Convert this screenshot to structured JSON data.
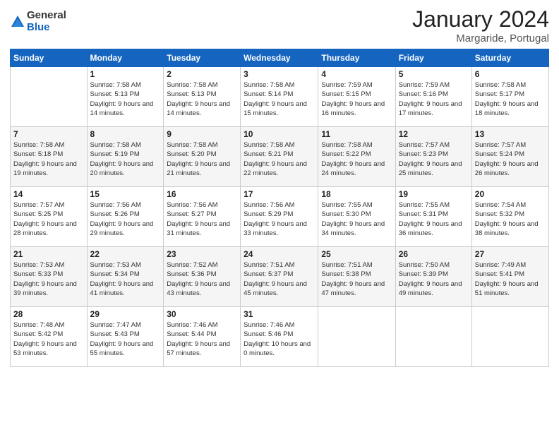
{
  "logo": {
    "general": "General",
    "blue": "Blue"
  },
  "header": {
    "title": "January 2024",
    "subtitle": "Margaride, Portugal"
  },
  "weekdays": [
    "Sunday",
    "Monday",
    "Tuesday",
    "Wednesday",
    "Thursday",
    "Friday",
    "Saturday"
  ],
  "weeks": [
    [
      {
        "day": "",
        "sunrise": "",
        "sunset": "",
        "daylight": ""
      },
      {
        "day": "1",
        "sunrise": "Sunrise: 7:58 AM",
        "sunset": "Sunset: 5:13 PM",
        "daylight": "Daylight: 9 hours and 14 minutes."
      },
      {
        "day": "2",
        "sunrise": "Sunrise: 7:58 AM",
        "sunset": "Sunset: 5:13 PM",
        "daylight": "Daylight: 9 hours and 14 minutes."
      },
      {
        "day": "3",
        "sunrise": "Sunrise: 7:58 AM",
        "sunset": "Sunset: 5:14 PM",
        "daylight": "Daylight: 9 hours and 15 minutes."
      },
      {
        "day": "4",
        "sunrise": "Sunrise: 7:59 AM",
        "sunset": "Sunset: 5:15 PM",
        "daylight": "Daylight: 9 hours and 16 minutes."
      },
      {
        "day": "5",
        "sunrise": "Sunrise: 7:59 AM",
        "sunset": "Sunset: 5:16 PM",
        "daylight": "Daylight: 9 hours and 17 minutes."
      },
      {
        "day": "6",
        "sunrise": "Sunrise: 7:58 AM",
        "sunset": "Sunset: 5:17 PM",
        "daylight": "Daylight: 9 hours and 18 minutes."
      }
    ],
    [
      {
        "day": "7",
        "sunrise": "Sunrise: 7:58 AM",
        "sunset": "Sunset: 5:18 PM",
        "daylight": "Daylight: 9 hours and 19 minutes."
      },
      {
        "day": "8",
        "sunrise": "Sunrise: 7:58 AM",
        "sunset": "Sunset: 5:19 PM",
        "daylight": "Daylight: 9 hours and 20 minutes."
      },
      {
        "day": "9",
        "sunrise": "Sunrise: 7:58 AM",
        "sunset": "Sunset: 5:20 PM",
        "daylight": "Daylight: 9 hours and 21 minutes."
      },
      {
        "day": "10",
        "sunrise": "Sunrise: 7:58 AM",
        "sunset": "Sunset: 5:21 PM",
        "daylight": "Daylight: 9 hours and 22 minutes."
      },
      {
        "day": "11",
        "sunrise": "Sunrise: 7:58 AM",
        "sunset": "Sunset: 5:22 PM",
        "daylight": "Daylight: 9 hours and 24 minutes."
      },
      {
        "day": "12",
        "sunrise": "Sunrise: 7:57 AM",
        "sunset": "Sunset: 5:23 PM",
        "daylight": "Daylight: 9 hours and 25 minutes."
      },
      {
        "day": "13",
        "sunrise": "Sunrise: 7:57 AM",
        "sunset": "Sunset: 5:24 PM",
        "daylight": "Daylight: 9 hours and 26 minutes."
      }
    ],
    [
      {
        "day": "14",
        "sunrise": "Sunrise: 7:57 AM",
        "sunset": "Sunset: 5:25 PM",
        "daylight": "Daylight: 9 hours and 28 minutes."
      },
      {
        "day": "15",
        "sunrise": "Sunrise: 7:56 AM",
        "sunset": "Sunset: 5:26 PM",
        "daylight": "Daylight: 9 hours and 29 minutes."
      },
      {
        "day": "16",
        "sunrise": "Sunrise: 7:56 AM",
        "sunset": "Sunset: 5:27 PM",
        "daylight": "Daylight: 9 hours and 31 minutes."
      },
      {
        "day": "17",
        "sunrise": "Sunrise: 7:56 AM",
        "sunset": "Sunset: 5:29 PM",
        "daylight": "Daylight: 9 hours and 33 minutes."
      },
      {
        "day": "18",
        "sunrise": "Sunrise: 7:55 AM",
        "sunset": "Sunset: 5:30 PM",
        "daylight": "Daylight: 9 hours and 34 minutes."
      },
      {
        "day": "19",
        "sunrise": "Sunrise: 7:55 AM",
        "sunset": "Sunset: 5:31 PM",
        "daylight": "Daylight: 9 hours and 36 minutes."
      },
      {
        "day": "20",
        "sunrise": "Sunrise: 7:54 AM",
        "sunset": "Sunset: 5:32 PM",
        "daylight": "Daylight: 9 hours and 38 minutes."
      }
    ],
    [
      {
        "day": "21",
        "sunrise": "Sunrise: 7:53 AM",
        "sunset": "Sunset: 5:33 PM",
        "daylight": "Daylight: 9 hours and 39 minutes."
      },
      {
        "day": "22",
        "sunrise": "Sunrise: 7:53 AM",
        "sunset": "Sunset: 5:34 PM",
        "daylight": "Daylight: 9 hours and 41 minutes."
      },
      {
        "day": "23",
        "sunrise": "Sunrise: 7:52 AM",
        "sunset": "Sunset: 5:36 PM",
        "daylight": "Daylight: 9 hours and 43 minutes."
      },
      {
        "day": "24",
        "sunrise": "Sunrise: 7:51 AM",
        "sunset": "Sunset: 5:37 PM",
        "daylight": "Daylight: 9 hours and 45 minutes."
      },
      {
        "day": "25",
        "sunrise": "Sunrise: 7:51 AM",
        "sunset": "Sunset: 5:38 PM",
        "daylight": "Daylight: 9 hours and 47 minutes."
      },
      {
        "day": "26",
        "sunrise": "Sunrise: 7:50 AM",
        "sunset": "Sunset: 5:39 PM",
        "daylight": "Daylight: 9 hours and 49 minutes."
      },
      {
        "day": "27",
        "sunrise": "Sunrise: 7:49 AM",
        "sunset": "Sunset: 5:41 PM",
        "daylight": "Daylight: 9 hours and 51 minutes."
      }
    ],
    [
      {
        "day": "28",
        "sunrise": "Sunrise: 7:48 AM",
        "sunset": "Sunset: 5:42 PM",
        "daylight": "Daylight: 9 hours and 53 minutes."
      },
      {
        "day": "29",
        "sunrise": "Sunrise: 7:47 AM",
        "sunset": "Sunset: 5:43 PM",
        "daylight": "Daylight: 9 hours and 55 minutes."
      },
      {
        "day": "30",
        "sunrise": "Sunrise: 7:46 AM",
        "sunset": "Sunset: 5:44 PM",
        "daylight": "Daylight: 9 hours and 57 minutes."
      },
      {
        "day": "31",
        "sunrise": "Sunrise: 7:46 AM",
        "sunset": "Sunset: 5:46 PM",
        "daylight": "Daylight: 10 hours and 0 minutes."
      },
      {
        "day": "",
        "sunrise": "",
        "sunset": "",
        "daylight": ""
      },
      {
        "day": "",
        "sunrise": "",
        "sunset": "",
        "daylight": ""
      },
      {
        "day": "",
        "sunrise": "",
        "sunset": "",
        "daylight": ""
      }
    ]
  ]
}
